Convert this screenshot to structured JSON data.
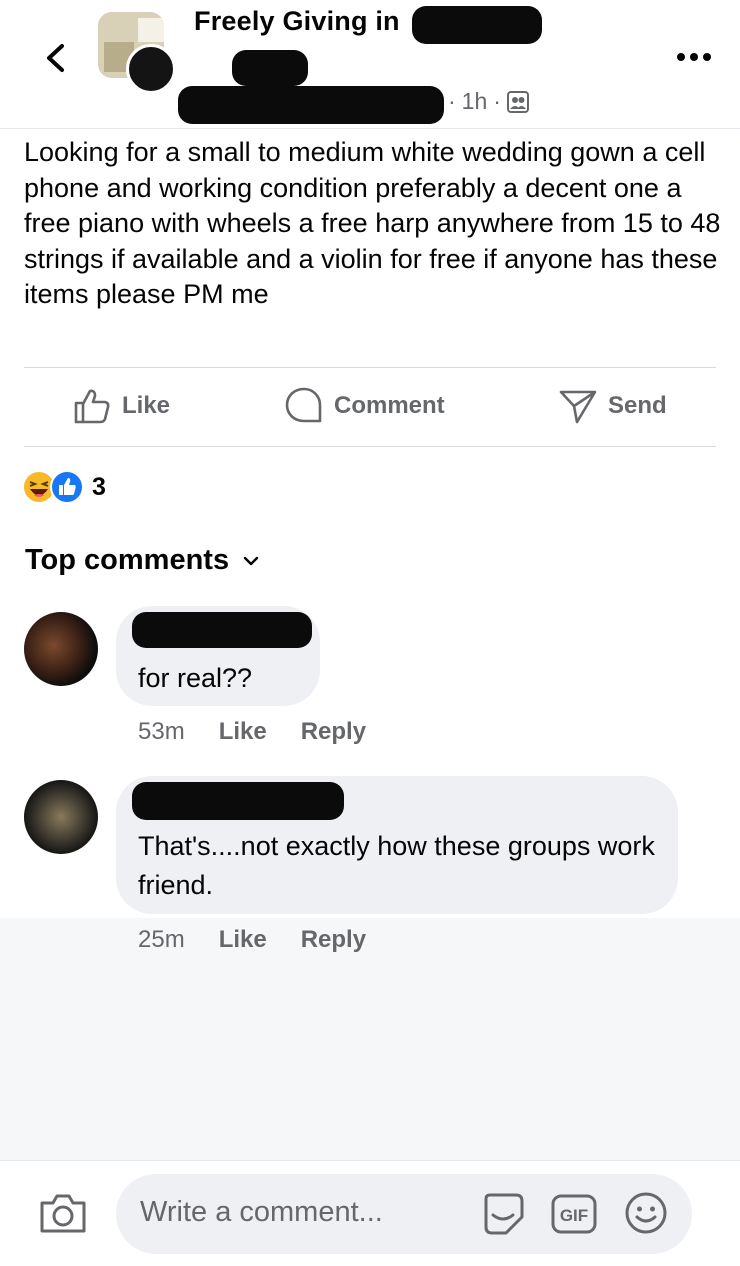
{
  "header": {
    "back_icon": "chevron-left-icon",
    "group_title": "Freely Giving in",
    "time": "1h",
    "audience_icon": "group-members-icon",
    "more_icon": "more-horizontal-icon"
  },
  "post": {
    "text": "Looking for a small to medium white wedding gown a cell phone and working condition preferably a decent one a free piano with wheels a free harp anywhere from 15 to 48 strings if available and a violin for free if anyone has these items please PM me"
  },
  "actions": {
    "like": "Like",
    "comment": "Comment",
    "send": "Send"
  },
  "reactions": {
    "count": "3",
    "types": [
      "haha",
      "like"
    ]
  },
  "comments_section": {
    "title": "Top comments"
  },
  "comments": [
    {
      "text": "for real??",
      "time": "53m",
      "like": "Like",
      "reply": "Reply"
    },
    {
      "text": "That's....not exactly how these groups work friend.",
      "time": "25m",
      "like": "Like",
      "reply": "Reply"
    }
  ],
  "composer": {
    "placeholder": "Write a comment...",
    "gif_label": "GIF"
  },
  "colors": {
    "text": "#050505",
    "secondary": "#65676b",
    "like_blue": "#1877f2",
    "haha_yellow": "#f7b928",
    "bubble": "#eff0f3"
  }
}
